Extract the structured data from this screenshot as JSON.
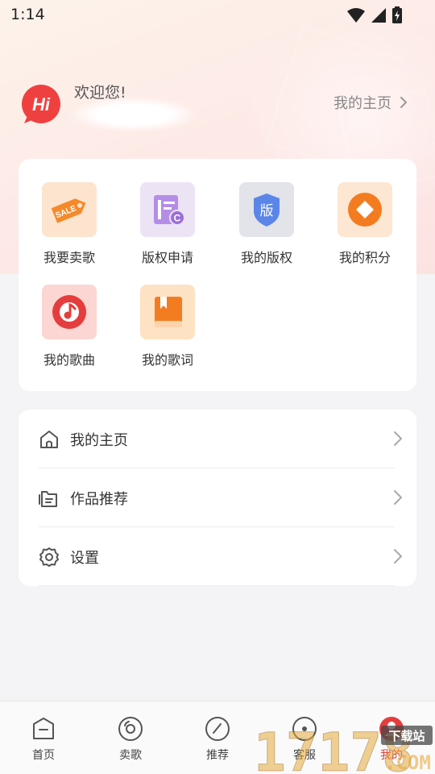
{
  "status_bar": {
    "time": "1:14"
  },
  "profile": {
    "avatar_text": "Hi",
    "welcome": "欢迎您!",
    "home_link": "我的主页"
  },
  "grid": [
    {
      "label": "我要卖歌",
      "icon": "sale-tag-icon"
    },
    {
      "label": "版权申请",
      "icon": "copyright-document-icon"
    },
    {
      "label": "我的版权",
      "icon": "copyright-shield-icon"
    },
    {
      "label": "我的积分",
      "icon": "points-coin-icon"
    },
    {
      "label": "我的歌曲",
      "icon": "music-disc-icon"
    },
    {
      "label": "我的歌词",
      "icon": "lyrics-book-icon"
    }
  ],
  "menu": [
    {
      "label": "我的主页",
      "icon": "home-icon"
    },
    {
      "label": "作品推荐",
      "icon": "works-folder-icon"
    },
    {
      "label": "设置",
      "icon": "settings-gear-icon"
    }
  ],
  "tabs": [
    {
      "label": "首页",
      "icon": "home-tab-icon",
      "active": false
    },
    {
      "label": "卖歌",
      "icon": "disc-tab-icon",
      "active": false
    },
    {
      "label": "推荐",
      "icon": "compass-tab-icon",
      "active": false
    },
    {
      "label": "客服",
      "icon": "service-tab-icon",
      "active": false
    },
    {
      "label": "我的",
      "icon": "profile-tab-icon",
      "active": true
    }
  ],
  "watermark": {
    "digits": "17178",
    "site_label": "下载站",
    "suffix": ".COM"
  },
  "colors": {
    "accent_red": "#e53d3d",
    "avatar_red": "#ef4040",
    "orange": "#f47c20",
    "purple": "#9b6fd6",
    "blue": "#5b86e8"
  }
}
